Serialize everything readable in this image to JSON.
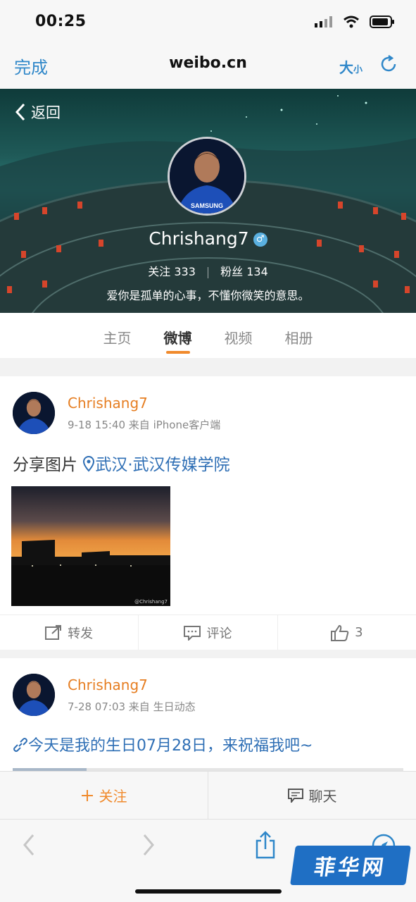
{
  "status_bar": {
    "time": "00:25"
  },
  "browser": {
    "done_label": "完成",
    "url": "weibo.cn",
    "size_label_big": "大",
    "size_label_small": "小"
  },
  "profile": {
    "back_label": "返回",
    "username": "Chrishang7",
    "gender_symbol": "♂",
    "following_label": "关注",
    "following_count": "333",
    "followers_label": "粉丝",
    "followers_count": "134",
    "bio": "爱你是孤单的心事，不懂你微笑的意思。",
    "jersey_text": "SAMSUNG"
  },
  "tabs": [
    {
      "label": "主页"
    },
    {
      "label": "微博"
    },
    {
      "label": "视频"
    },
    {
      "label": "相册"
    }
  ],
  "active_tab": "微博",
  "posts": [
    {
      "author": "Chrishang7",
      "meta": "9-18 15:40 来自 iPhone客户端",
      "text": "分享图片",
      "location": "武汉·武汉传媒学院",
      "photo_watermark": "@Chrishang7",
      "actions": {
        "repost": "转发",
        "comment": "评论",
        "like_count": "3"
      }
    },
    {
      "author": "Chrishang7",
      "meta": "7-28 07:03 来自 生日动态",
      "text": "今天是我的生日07月28日，来祝福我吧~",
      "progress": 0.19
    }
  ],
  "bottom_bar": {
    "follow_label": "关注",
    "chat_label": "聊天"
  },
  "watermark": {
    "text": "菲华网"
  },
  "colors": {
    "accent_blue": "#2f87c9",
    "orange": "#f08a2c",
    "name_orange": "#e67e22",
    "location_blue": "#2f6fb5"
  }
}
